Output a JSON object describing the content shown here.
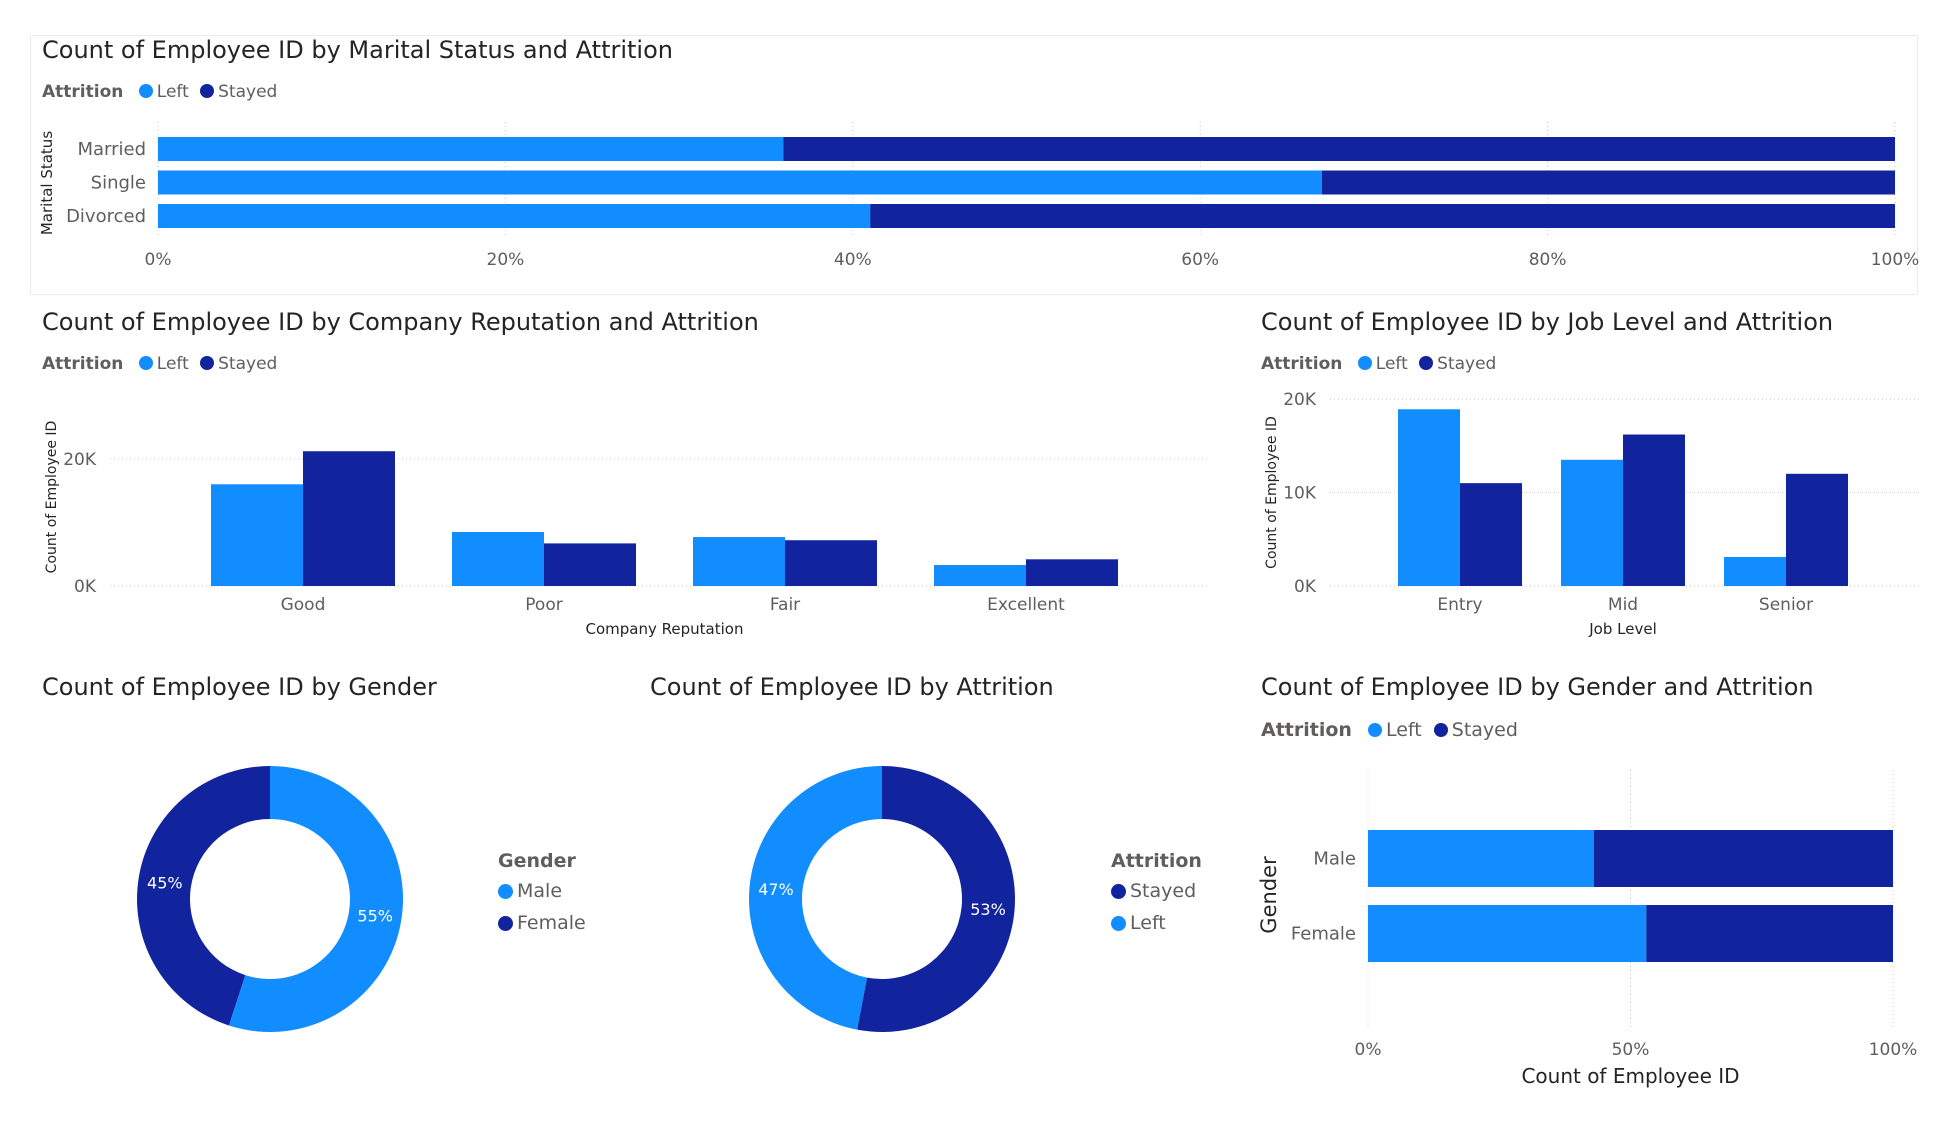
{
  "colors": {
    "left": "#118dff",
    "stayed": "#12239e",
    "grid": "#c8c6c4",
    "axis_text": "#605e5c"
  },
  "marital": {
    "title": "Count of Employee ID by Marital Status and Attrition",
    "legend": {
      "title": "Attrition",
      "items": [
        "Left",
        "Stayed"
      ]
    }
  },
  "reputation": {
    "title": "Count of Employee ID by Company Reputation and Attrition",
    "legend": {
      "title": "Attrition",
      "items": [
        "Left",
        "Stayed"
      ]
    }
  },
  "joblevel": {
    "title": "Count of Employee ID by Job Level and Attrition",
    "legend": {
      "title": "Attrition",
      "items": [
        "Left",
        "Stayed"
      ]
    }
  },
  "gender_donut": {
    "title": "Count of Employee ID by Gender",
    "legend": {
      "title": "Gender",
      "items": [
        "Male",
        "Female"
      ]
    }
  },
  "attrition_donut": {
    "title": "Count of Employee ID by Attrition",
    "legend": {
      "title": "Attrition",
      "items": [
        "Stayed",
        "Left"
      ]
    }
  },
  "gender_attrition": {
    "title": "Count of Employee ID by Gender and Attrition",
    "legend": {
      "title": "Attrition",
      "items": [
        "Left",
        "Stayed"
      ]
    }
  },
  "chart_data": [
    {
      "id": "marital",
      "type": "bar",
      "orientation": "horizontal",
      "stacking": "100%",
      "title": "Count of Employee ID by Marital Status and Attrition",
      "ylabel": "Marital Status",
      "xlabel": "",
      "categories": [
        "Married",
        "Single",
        "Divorced"
      ],
      "series": [
        {
          "name": "Left",
          "values": [
            36,
            67,
            41
          ]
        },
        {
          "name": "Stayed",
          "values": [
            64,
            33,
            59
          ]
        }
      ],
      "xticks": [
        "0%",
        "20%",
        "40%",
        "60%",
        "80%",
        "100%"
      ],
      "xlim": [
        0,
        100
      ],
      "grid": true,
      "legend_position": "top-left"
    },
    {
      "id": "reputation",
      "type": "bar",
      "orientation": "vertical",
      "stacking": "clustered",
      "title": "Count of Employee ID by Company Reputation and Attrition",
      "xlabel": "Company Reputation",
      "ylabel": "Count of Employee ID",
      "categories": [
        "Good",
        "Poor",
        "Fair",
        "Excellent"
      ],
      "series": [
        {
          "name": "Left",
          "values": [
            16000,
            8500,
            7700,
            3300
          ]
        },
        {
          "name": "Stayed",
          "values": [
            21200,
            6700,
            7200,
            4200
          ]
        }
      ],
      "yticks": [
        "0K",
        "20K"
      ],
      "ylim": [
        0,
        28000
      ],
      "grid": true,
      "legend_position": "top-left"
    },
    {
      "id": "joblevel",
      "type": "bar",
      "orientation": "vertical",
      "stacking": "clustered",
      "title": "Count of Employee ID by Job Level and Attrition",
      "xlabel": "Job Level",
      "ylabel": "Count of Employee ID",
      "categories": [
        "Entry",
        "Mid",
        "Senior"
      ],
      "series": [
        {
          "name": "Left",
          "values": [
            18900,
            13500,
            3100
          ]
        },
        {
          "name": "Stayed",
          "values": [
            11000,
            16200,
            12000
          ]
        }
      ],
      "yticks": [
        "0K",
        "10K",
        "20K"
      ],
      "ylim": [
        0,
        20000
      ],
      "grid": true,
      "legend_position": "top-left"
    },
    {
      "id": "gender_donut",
      "type": "pie",
      "donut": true,
      "title": "Count of Employee ID by Gender",
      "labels": [
        "Male",
        "Female"
      ],
      "values": [
        55,
        45
      ],
      "data_labels": [
        "55%",
        "45%"
      ],
      "legend_position": "right"
    },
    {
      "id": "attrition_donut",
      "type": "pie",
      "donut": true,
      "title": "Count of Employee ID by Attrition",
      "labels": [
        "Stayed",
        "Left"
      ],
      "values": [
        53,
        47
      ],
      "data_labels": [
        "53%",
        "47%"
      ],
      "legend_position": "right"
    },
    {
      "id": "gender_attrition",
      "type": "bar",
      "orientation": "horizontal",
      "stacking": "100%",
      "title": "Count of Employee ID by Gender and Attrition",
      "ylabel": "Gender",
      "xlabel": "Count of Employee ID",
      "categories": [
        "Male",
        "Female"
      ],
      "series": [
        {
          "name": "Left",
          "values": [
            43,
            53
          ]
        },
        {
          "name": "Stayed",
          "values": [
            57,
            47
          ]
        }
      ],
      "xticks": [
        "0%",
        "50%",
        "100%"
      ],
      "xlim": [
        0,
        100
      ],
      "grid": true,
      "legend_position": "top-left"
    }
  ]
}
